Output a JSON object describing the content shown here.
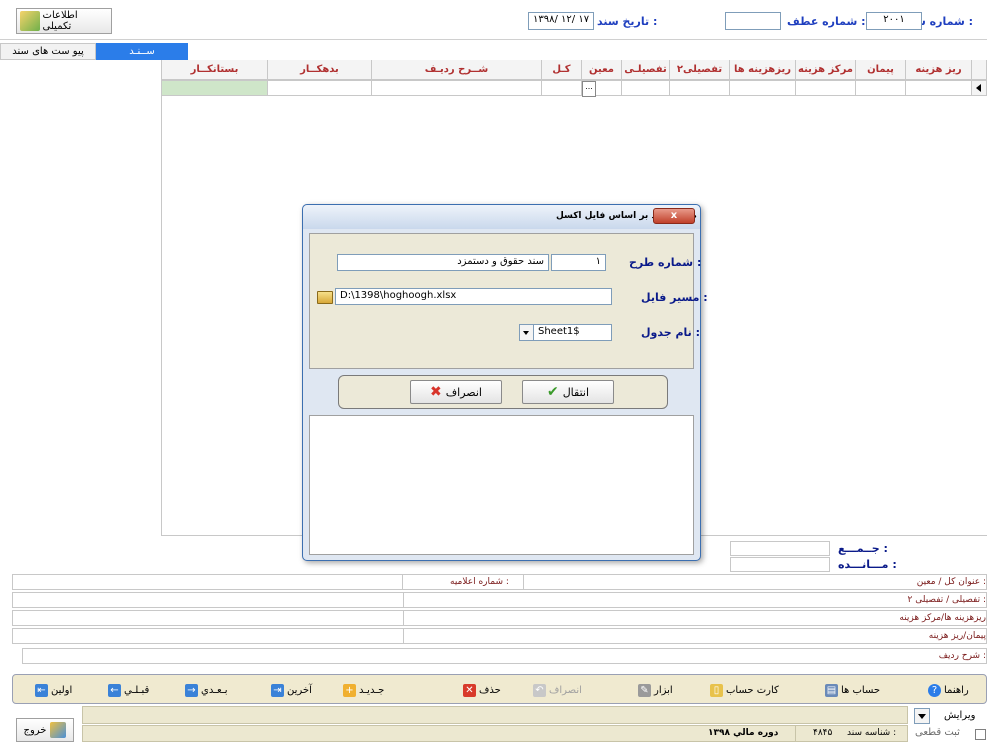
{
  "header": {
    "doc_number_label": "شماره سند :",
    "doc_number_value": "۲۰۰۱",
    "ref_number_label": "شماره عطف :",
    "ref_number_value": "",
    "doc_date_label": "تاریخ سند :",
    "doc_date_value": "۱۳۹۸/ ۱۲/ ۱۷",
    "extra_info_label": "اطلاعات تکمیلی"
  },
  "tabs": [
    {
      "label": "ســنـد"
    },
    {
      "label": "پیو ست های سند"
    }
  ],
  "grid": {
    "columns": [
      "ریز هزینه",
      "پیمان",
      "مرکز هزینه",
      "ریزهزینه ها",
      "تفصیلی۲",
      "تفصیلـی",
      "معین",
      "کـل",
      "شــرح ردیـف",
      "بدهکــار",
      "بستانکــار"
    ],
    "ellipsis": "..."
  },
  "totals": {
    "sum_label": "جــمـــع :",
    "remain_label": "مـــانـــده :"
  },
  "info": {
    "notice_number_label": "شماره اعلامیه :",
    "rows": [
      {
        "label": "عنوان کل / معین    :"
      },
      {
        "label": "تفصیلی / تفصیلی ۲ :"
      },
      {
        "label": "ریزهزینه ها/مرکز هزینه"
      },
      {
        "label": "پیمان/ریز هزینه"
      },
      {
        "label": "شرح ردیف           :"
      }
    ]
  },
  "toolbar": {
    "help": "راهنما",
    "accounts": "حساب ها",
    "account_card": "کارت حساب",
    "tools": "ابزار",
    "cancel": "انصراف",
    "delete": "حذف",
    "new": "جـديـد",
    "last": "آخرين",
    "next": "بـعـدي",
    "prev": "قبـلـي",
    "first": "اولين"
  },
  "status": {
    "mode_value": "ويرايش",
    "final_register_label": "ثبت قطعی",
    "doc_id_label": "شناسه سند :",
    "doc_id_value": "۴۸۴۵",
    "fiscal_period": "دوره مالي ۱۳۹۸",
    "exit_label": "خروج"
  },
  "dialog": {
    "title": "صدور سند بر اساس فایل اکسل",
    "close_symbol": "x",
    "plan_number_label": "شماره طرح :",
    "plan_number_value": "۱",
    "plan_name_value": "سند حقوق و دستمزد",
    "file_path_label": "مسیر فایل :",
    "file_path_value": "D:\\1398\\hoghoogh.xlsx",
    "table_name_label": "نام جدول :",
    "table_name_value": "Sheet1$",
    "transfer_button": "انتقال",
    "cancel_button": "انصراف"
  },
  "colors": {
    "toolbar_bg": "#f0ead0",
    "tab_active": "#2b7de9",
    "status_bg": "#ece8d0",
    "credit_cell": "#cfe6c9",
    "dialog_border": "#3c6fb0"
  }
}
